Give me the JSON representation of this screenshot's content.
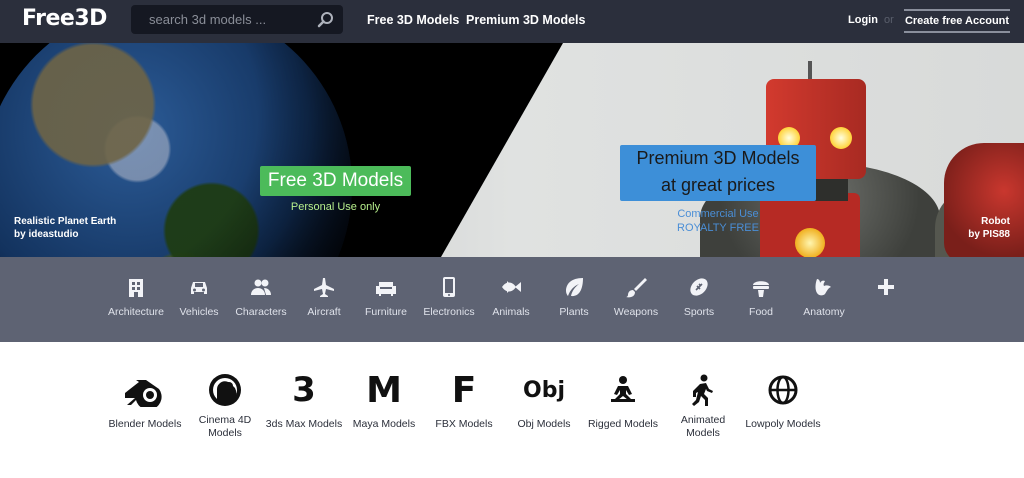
{
  "header": {
    "logo": "Free3D",
    "search_placeholder": "search 3d models ...",
    "nav": [
      "Free 3D Models",
      "Premium 3D Models"
    ],
    "login": "Login",
    "or": "or",
    "create_account": "Create free Account"
  },
  "hero": {
    "free_title": "Free 3D Models",
    "free_sub": "Personal Use only",
    "premium_title_1": "Premium 3D Models",
    "premium_title_2": "at great prices",
    "premium_sub_1": "Commercial Use",
    "premium_sub_2": "ROYALTY FREE",
    "left_credit_title": "Realistic Planet Earth",
    "left_credit_by": "by ideastudio",
    "right_credit_title": "Robot",
    "right_credit_by": "by PIS88"
  },
  "categories": [
    {
      "label": "Architecture",
      "icon": "building-icon"
    },
    {
      "label": "Vehicles",
      "icon": "car-icon"
    },
    {
      "label": "Characters",
      "icon": "users-icon"
    },
    {
      "label": "Aircraft",
      "icon": "plane-icon"
    },
    {
      "label": "Furniture",
      "icon": "sofa-icon"
    },
    {
      "label": "Electronics",
      "icon": "phone-icon"
    },
    {
      "label": "Animals",
      "icon": "fish-icon"
    },
    {
      "label": "Plants",
      "icon": "leaf-icon"
    },
    {
      "label": "Weapons",
      "icon": "brush-icon"
    },
    {
      "label": "Sports",
      "icon": "football-icon"
    },
    {
      "label": "Food",
      "icon": "food-icon"
    },
    {
      "label": "Anatomy",
      "icon": "anatomy-icon"
    },
    {
      "label": "",
      "icon": "plus-icon"
    }
  ],
  "formats": [
    {
      "label": "Blender Models",
      "icon": "blender-icon"
    },
    {
      "label_1": "Cinema 4D",
      "label_2": "Models",
      "icon": "cinema4d-icon"
    },
    {
      "label": "3ds Max Models",
      "icon_text": "3"
    },
    {
      "label": "Maya Models",
      "icon_text": "M"
    },
    {
      "label": "FBX Models",
      "icon_text": "F"
    },
    {
      "label": "Obj Models",
      "icon_text": "Obj"
    },
    {
      "label": "Rigged Models",
      "icon": "rigged-icon"
    },
    {
      "label_1": "Animated",
      "label_2": "Models",
      "icon": "walking-icon"
    },
    {
      "label": "Lowpoly Models",
      "icon": "globe-icon"
    }
  ]
}
